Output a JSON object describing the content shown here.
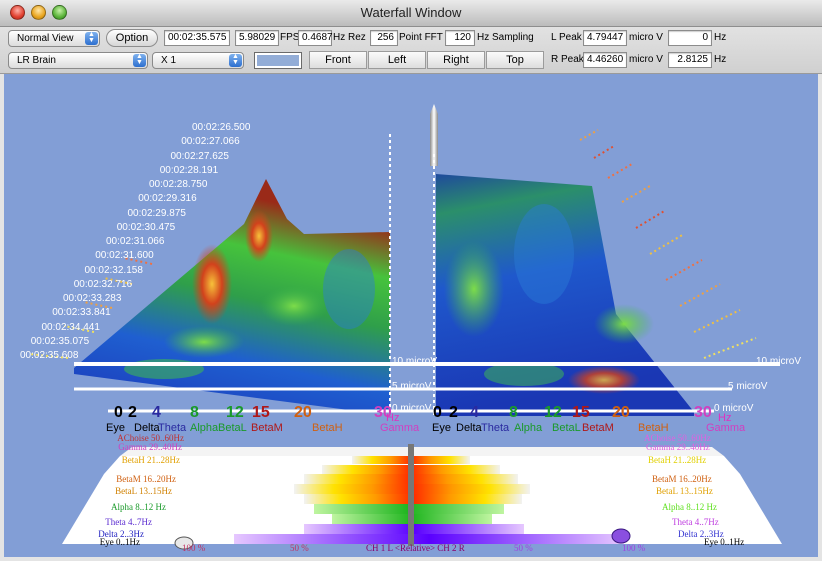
{
  "window": {
    "title": "Waterfall Window"
  },
  "colors": {
    "background": "#829ed6",
    "swatch": "#93add7"
  },
  "toolbar": {
    "view_mode": "Normal View",
    "option_label": "Option",
    "time": "00:02:35.575",
    "fps_value": "5.98029",
    "fps_unit": "FPS",
    "hz_rez_value": "0.4687",
    "hz_rez_unit": "Hz Rez",
    "fft_points": "256",
    "fft_unit": "Point FFT",
    "sampling_value": "120",
    "sampling_unit": "Hz Sampling",
    "l_peak_label": "L Peak",
    "l_peak_value": "4.79447",
    "l_peak_unit": "micro V",
    "l_hz_value": "0",
    "l_hz_unit": "Hz",
    "r_peak_label": "R Peak",
    "r_peak_value": "4.46260",
    "r_peak_unit": "micro V",
    "r_hz_value": "2.8125",
    "r_hz_unit": "Hz",
    "montage": "LR Brain",
    "scale": "X 1",
    "front_label": "Front",
    "left_label": "Left",
    "right_label": "Right",
    "top_label": "Top"
  },
  "waterfall": {
    "time_labels": [
      "00:02:26.500",
      "00:02:27.066",
      "00:02:27.625",
      "00:02:28.191",
      "00:02:28.750",
      "00:02:29.316",
      "00:02:29.875",
      "00:02:30.475",
      "00:02:31.066",
      "00:02:31.600",
      "00:02:32.158",
      "00:02:32.716",
      "00:02:33.283",
      "00:02:33.841",
      "00:02:34.441",
      "00:02:35.075",
      "00:02:35.608"
    ],
    "amplitude_labels": [
      "10 microV",
      "5 microV",
      "0 microV"
    ],
    "freq_ticks": [
      "0",
      "2",
      "4",
      "8",
      "12",
      "15",
      "20",
      "30"
    ],
    "hz_unit": "Hz",
    "band_names": [
      "Eye",
      "Delta",
      "Theta",
      "Alpha",
      "BetaL",
      "BetaM",
      "BetaH",
      "Gamma"
    ]
  },
  "bands": {
    "left": [
      "AChoise 50..60Hz",
      "Gamma 29..40Hz",
      "BetaH 21..28Hz",
      "BetaM 16..20Hz",
      "BetaL 13..15Hz",
      "Alpha 8..12 Hz",
      "Theta 4..7Hz",
      "Delta 2..3Hz",
      "Eye 0..1Hz"
    ],
    "right": [
      "AChoise 50..60Hz",
      "Gamma 29..40Hz",
      "BetaH 21..28Hz",
      "BetaM 16..20Hz",
      "BetaL 13..15Hz",
      "Alpha 8..12 Hz",
      "Theta 4..7Hz",
      "Delta 2..3Hz",
      "Eye 0..1Hz"
    ],
    "bottom_labels": [
      "100 %",
      "50 %",
      "CH 1 L <Relative> CH 2 R",
      "50 %",
      "100 %"
    ]
  }
}
